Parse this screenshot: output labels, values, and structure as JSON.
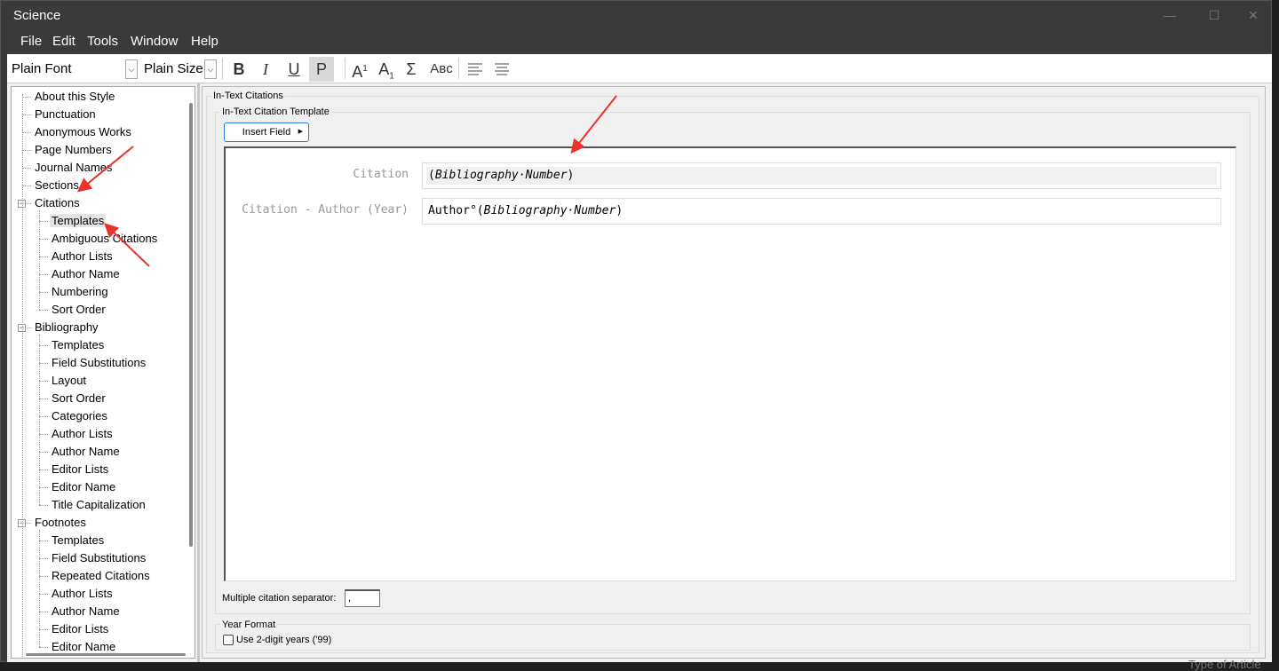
{
  "window": {
    "title": "Science",
    "minimize_icon": "minimize-icon",
    "maximize_icon": "maximize-icon",
    "close_icon": "close-icon",
    "min_glyph": "—",
    "max_glyph": "☐",
    "close_glyph": "✕"
  },
  "menu": [
    "File",
    "Edit",
    "Tools",
    "Window",
    "Help"
  ],
  "toolbar": {
    "font": "Plain Font",
    "size": "Plain Size",
    "bold": "B",
    "italic": "I",
    "underline": "U",
    "plain": "P",
    "superscript": "A",
    "superscript_mark": "1",
    "subscript": "A",
    "subscript_mark": "1",
    "symbol": "Σ",
    "smallcaps": "Aʙᴄ",
    "dropdown_glyph": "⌵"
  },
  "tree": {
    "items": [
      {
        "label": "About this Style",
        "level": 0,
        "expand": ""
      },
      {
        "label": "Punctuation",
        "level": 0,
        "expand": ""
      },
      {
        "label": "Anonymous Works",
        "level": 0,
        "expand": ""
      },
      {
        "label": "Page Numbers",
        "level": 0,
        "expand": ""
      },
      {
        "label": "Journal Names",
        "level": 0,
        "expand": ""
      },
      {
        "label": "Sections",
        "level": 0,
        "expand": ""
      },
      {
        "label": "Citations",
        "level": 0,
        "expand": "−"
      },
      {
        "label": "Templates",
        "level": 1,
        "expand": "",
        "selected": true
      },
      {
        "label": "Ambiguous Citations",
        "level": 1,
        "expand": ""
      },
      {
        "label": "Author Lists",
        "level": 1,
        "expand": ""
      },
      {
        "label": "Author Name",
        "level": 1,
        "expand": ""
      },
      {
        "label": "Numbering",
        "level": 1,
        "expand": ""
      },
      {
        "label": "Sort Order",
        "level": 1,
        "expand": ""
      },
      {
        "label": "Bibliography",
        "level": 0,
        "expand": "−"
      },
      {
        "label": "Templates",
        "level": 1,
        "expand": ""
      },
      {
        "label": "Field Substitutions",
        "level": 1,
        "expand": ""
      },
      {
        "label": "Layout",
        "level": 1,
        "expand": ""
      },
      {
        "label": "Sort Order",
        "level": 1,
        "expand": ""
      },
      {
        "label": "Categories",
        "level": 1,
        "expand": ""
      },
      {
        "label": "Author Lists",
        "level": 1,
        "expand": ""
      },
      {
        "label": "Author Name",
        "level": 1,
        "expand": ""
      },
      {
        "label": "Editor Lists",
        "level": 1,
        "expand": ""
      },
      {
        "label": "Editor Name",
        "level": 1,
        "expand": ""
      },
      {
        "label": "Title Capitalization",
        "level": 1,
        "expand": ""
      },
      {
        "label": "Footnotes",
        "level": 0,
        "expand": "−"
      },
      {
        "label": "Templates",
        "level": 1,
        "expand": ""
      },
      {
        "label": "Field Substitutions",
        "level": 1,
        "expand": ""
      },
      {
        "label": "Repeated Citations",
        "level": 1,
        "expand": ""
      },
      {
        "label": "Author Lists",
        "level": 1,
        "expand": ""
      },
      {
        "label": "Author Name",
        "level": 1,
        "expand": ""
      },
      {
        "label": "Editor Lists",
        "level": 1,
        "expand": ""
      },
      {
        "label": "Editor Name",
        "level": 1,
        "expand": ""
      }
    ]
  },
  "main": {
    "group_title": "In-Text Citations",
    "template_group_title": "In-Text Citation Template",
    "insert_field": "Insert Field",
    "insert_field_glyph": "▶",
    "rows": [
      {
        "label": "Citation",
        "prefix": "(",
        "field": "Bibliography·Number",
        "suffix": ")"
      },
      {
        "label": "Citation - Author (Year)",
        "prefix": "Author°(",
        "field": "Bibliography·Number",
        "suffix": ")"
      }
    ],
    "separator_label": "Multiple citation separator:",
    "separator_value": ",",
    "year_format_title": "Year Format",
    "year_checkbox_label": "Use 2-digit years ('99)",
    "year_checkbox_checked": false
  },
  "background_text": "Type of Article",
  "annotation_color": "#e8332a"
}
